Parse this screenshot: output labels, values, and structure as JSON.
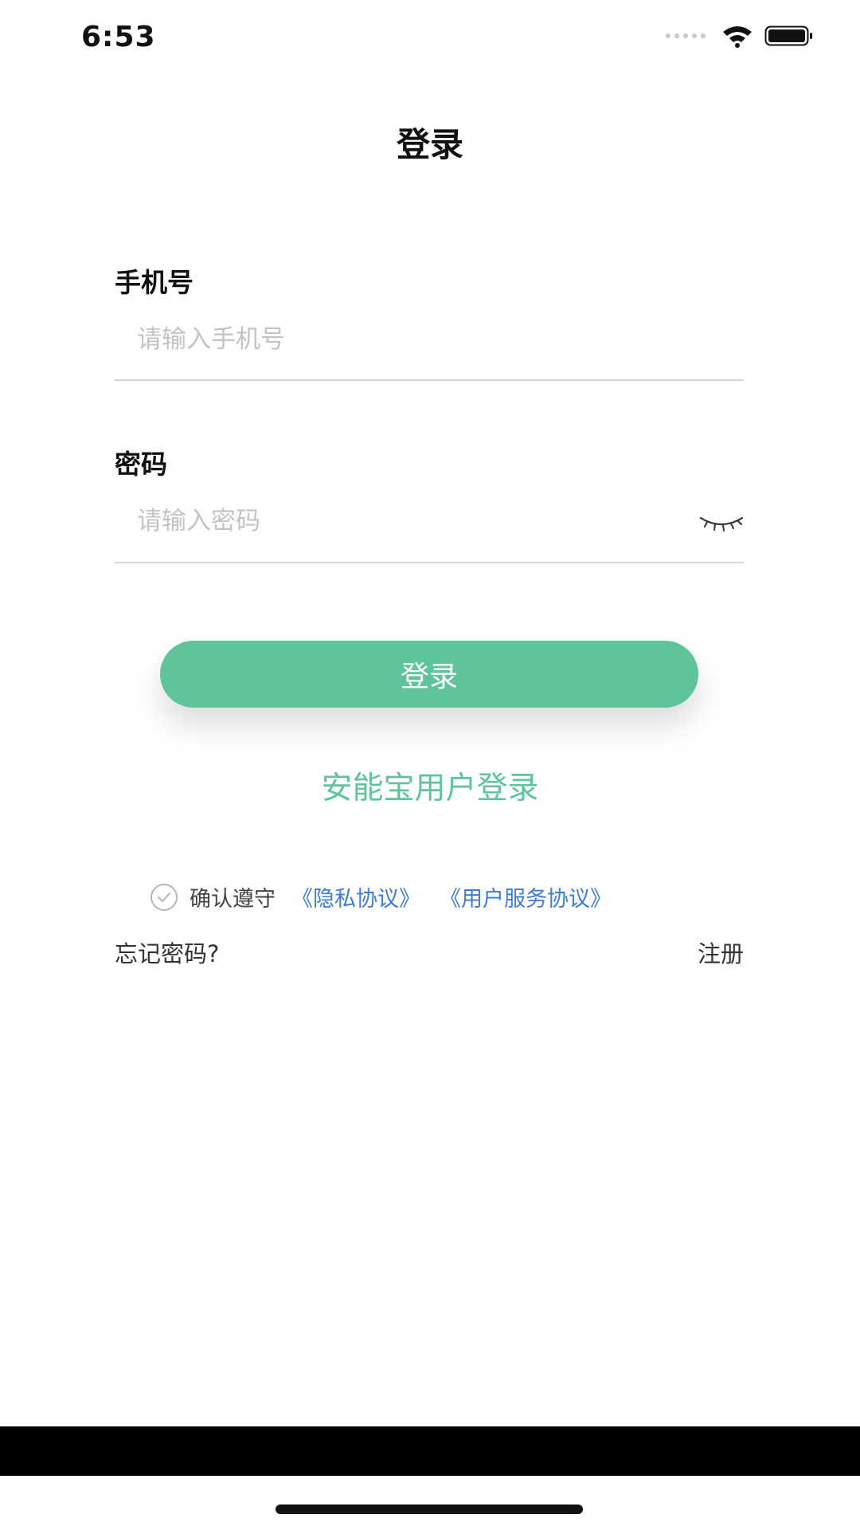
{
  "status_bar": {
    "time": "6:53"
  },
  "nav": {
    "title": "登录"
  },
  "form": {
    "phone_label": "手机号",
    "phone_placeholder": "请输入手机号",
    "phone_value": "",
    "password_label": "密码",
    "password_placeholder": "请输入密码",
    "password_value": ""
  },
  "actions": {
    "login_label": "登录",
    "alt_login_label": "安能宝用户登录"
  },
  "agreement": {
    "confirm_text": "确认遵守",
    "privacy_link": "《隐私协议》",
    "service_link": "《用户服务协议》"
  },
  "footer_links": {
    "forgot_password": "忘记密码?",
    "register": "注册"
  },
  "colors": {
    "accent": "#5fc39c",
    "link": "#3e7bd8"
  },
  "icons": {
    "signal": "signal-dots-icon",
    "wifi": "wifi-icon",
    "battery": "battery-icon",
    "password_toggle": "eye-closed-icon",
    "agreement_check": "check-circle-icon"
  }
}
